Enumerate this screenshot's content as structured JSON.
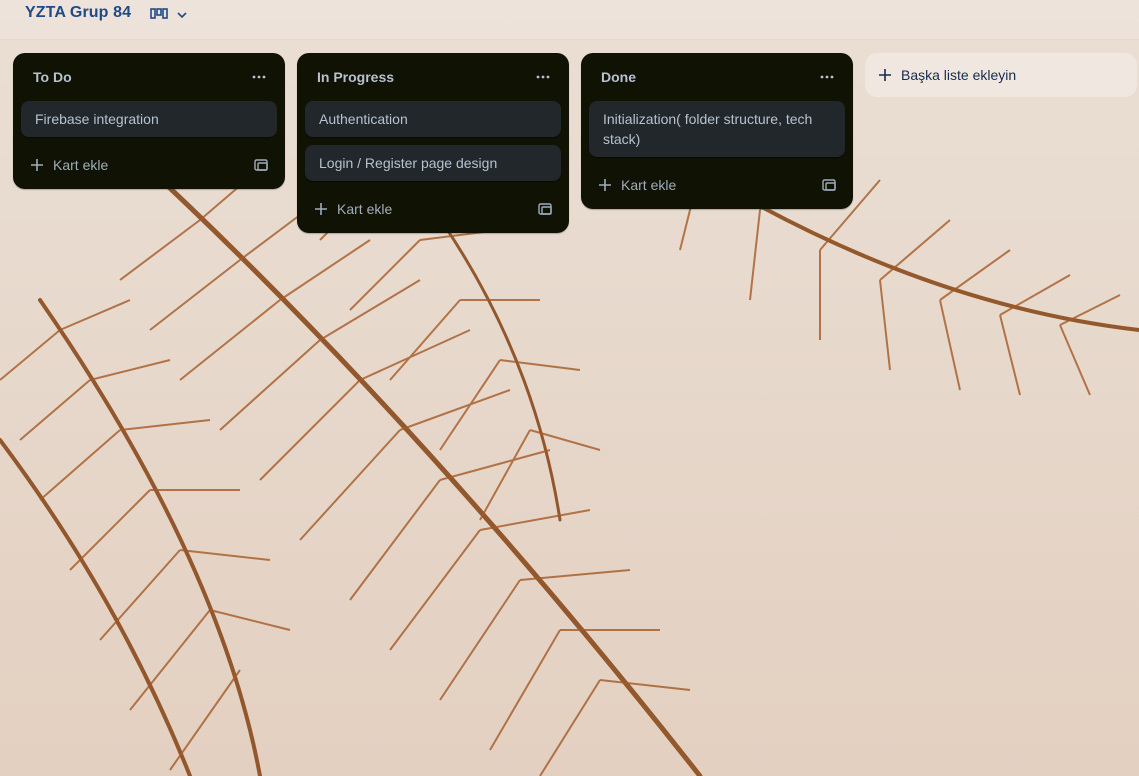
{
  "board": {
    "title": "YZTA Grup 84"
  },
  "view_switch": {
    "icon": "board-view-icon",
    "chevron": "chevron-down-icon"
  },
  "lists": [
    {
      "title": "To Do",
      "cards": [
        "Firebase integration"
      ],
      "add_card_label": "Kart ekle"
    },
    {
      "title": "In Progress",
      "cards": [
        "Authentication",
        "Login / Register page design"
      ],
      "add_card_label": "Kart ekle"
    },
    {
      "title": "Done",
      "cards": [
        "Initialization( folder structure, tech stack)"
      ],
      "add_card_label": "Kart ekle"
    }
  ],
  "add_list": {
    "label": "Başka liste ekleyin"
  },
  "colors": {
    "list_bg": "#101204",
    "card_bg": "#22272b",
    "text": "#b6c2cf",
    "title": "#1f4a86"
  }
}
